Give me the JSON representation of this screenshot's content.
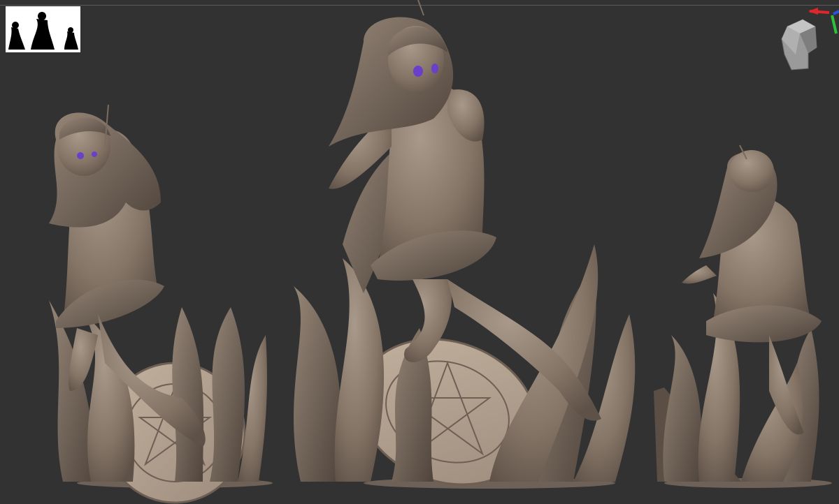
{
  "app": {
    "viewport_background": "#323232",
    "sculpt_color": "#8a7a6c",
    "eye_color": "#6a3fc9"
  },
  "icons": {
    "thumbnail": "silhouette-thumbnail-icon",
    "navigation": "head-navigation-cube-icon",
    "axis_x": "#e0262a",
    "axis_y": "#2fbf3a",
    "axis_z": "#2a55e0"
  },
  "views": [
    {
      "name": "front-left-view"
    },
    {
      "name": "side-view"
    },
    {
      "name": "back-view"
    }
  ]
}
